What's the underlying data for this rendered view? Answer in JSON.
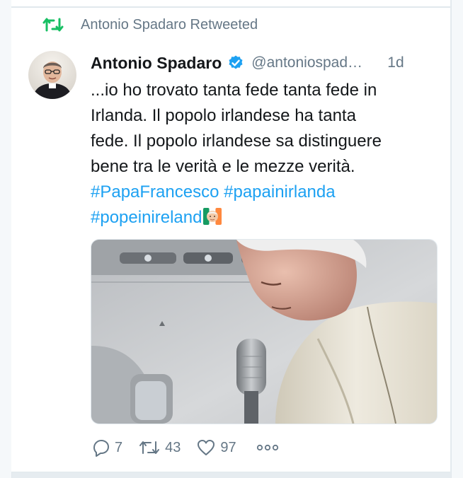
{
  "retweet": {
    "label": "Antonio Spadaro Retweeted",
    "icon": "retweet-icon",
    "color": "#17bf63"
  },
  "tweet": {
    "author_name": "Antonio Spadaro",
    "handle": "@antoniospad…",
    "timestamp": "1d",
    "verified_icon": "verified-badge-icon",
    "text": "...io ho trovato tanta fede tanta fede in Irlanda. Il popolo irlandese ha tanta fede. Il popolo irlandese sa distinguere bene tra le verità e le mezze verità.",
    "line1": "...io ho trovato tanta fede tanta fede in",
    "line2": "Irlanda. Il popolo irlandese ha tanta",
    "line3": "fede. Il popolo irlandese sa distinguere",
    "line4": "bene tra le verità e le mezze verità.",
    "hashtags": [
      "#PapaFrancesco",
      "#papainirlanda",
      "#popeinireland"
    ],
    "emoji": "flag-ireland-pope-emoji"
  },
  "actions": {
    "reply_count": "7",
    "retweet_count": "43",
    "like_count": "97",
    "reply_icon": "reply-icon",
    "retweet_icon": "retweet-icon",
    "like_icon": "heart-icon",
    "more_icon": "more-icon"
  },
  "colors": {
    "link": "#1da1f2",
    "secondary_text": "#657786",
    "primary_text": "#14171a",
    "retweet_green": "#17bf63"
  }
}
